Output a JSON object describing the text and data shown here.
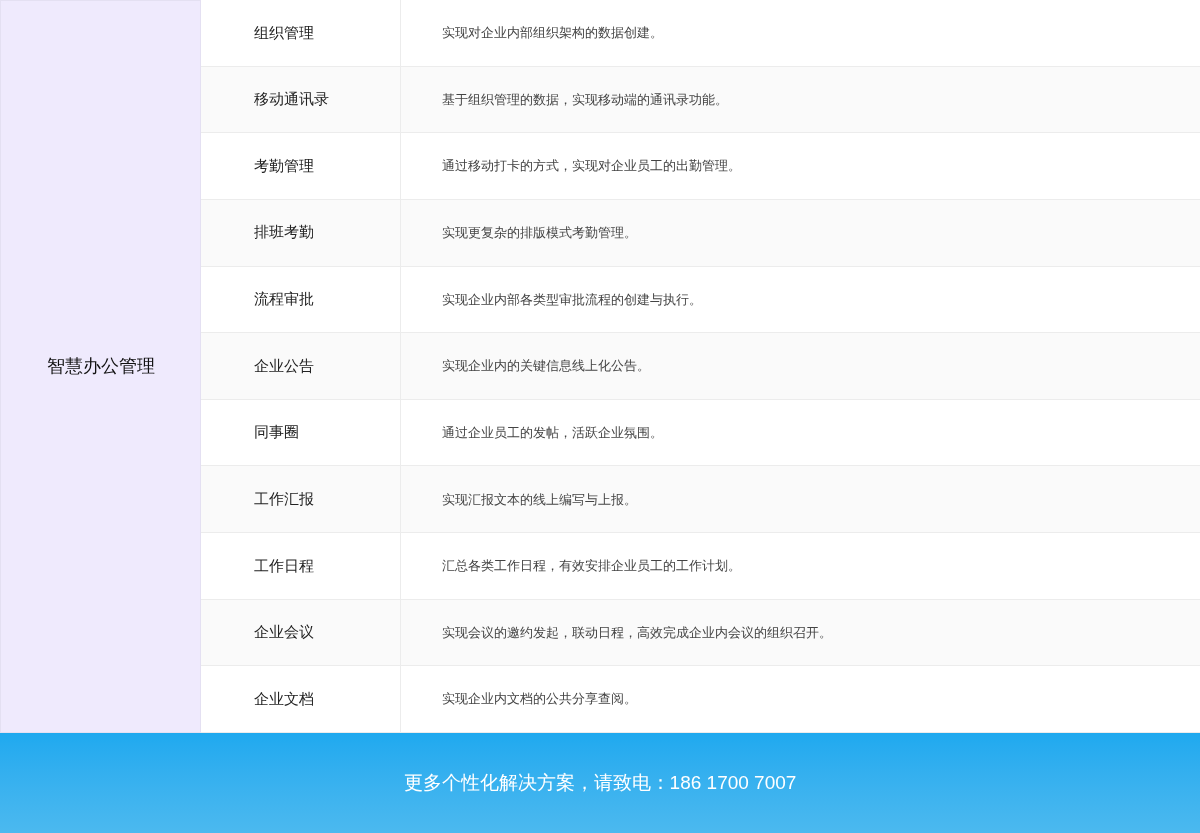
{
  "category": "智慧办公管理",
  "rows": [
    {
      "name": "组织管理",
      "description": "实现对企业内部组织架构的数据创建。"
    },
    {
      "name": "移动通讯录",
      "description": "基于组织管理的数据，实现移动端的通讯录功能。"
    },
    {
      "name": "考勤管理",
      "description": "通过移动打卡的方式，实现对企业员工的出勤管理。"
    },
    {
      "name": "排班考勤",
      "description": "实现更复杂的排版模式考勤管理。"
    },
    {
      "name": "流程审批",
      "description": "实现企业内部各类型审批流程的创建与执行。"
    },
    {
      "name": "企业公告",
      "description": "实现企业内的关键信息线上化公告。"
    },
    {
      "name": "同事圈",
      "description": "通过企业员工的发帖，活跃企业氛围。"
    },
    {
      "name": "工作汇报",
      "description": "实现汇报文本的线上编写与上报。"
    },
    {
      "name": "工作日程",
      "description": "汇总各类工作日程，有效安排企业员工的工作计划。"
    },
    {
      "name": "企业会议",
      "description": "实现会议的邀约发起，联动日程，高效完成企业内会议的组织召开。"
    },
    {
      "name": "企业文档",
      "description": "实现企业内文档的公共分享查阅。"
    }
  ],
  "footer": "更多个性化解决方案，请致电：186 1700 7007"
}
